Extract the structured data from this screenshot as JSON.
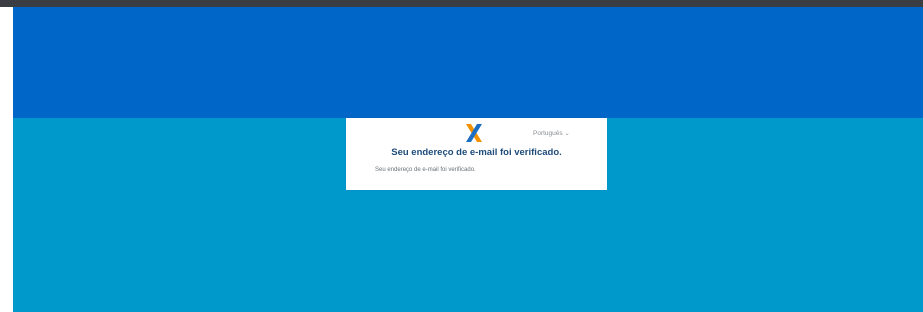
{
  "colors": {
    "topbar": "#3a3d42",
    "hero_band": "#0066c8",
    "page_body": "#0099cc",
    "card_background": "#ffffff",
    "title_text": "#1e4b7a",
    "logo_orange": "#f39200",
    "logo_blue": "#1d6fc4"
  },
  "card": {
    "logo_icon": "caixa-x-logo",
    "language": {
      "selected": "Português",
      "icon": "chevron-down-icon"
    },
    "title": "Seu endereço de e-mail foi verificado.",
    "message": "Seu endereço de e-mail foi verificado."
  }
}
